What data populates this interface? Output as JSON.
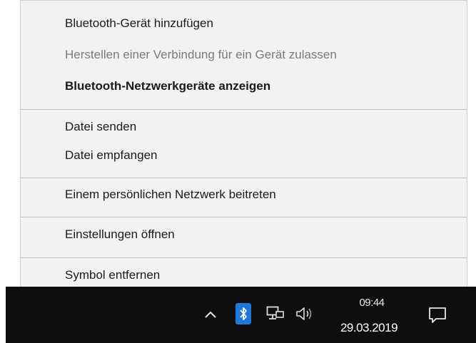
{
  "menu": {
    "items": [
      {
        "label": "Bluetooth-Gerät hinzufügen",
        "state": "normal"
      },
      {
        "label": "Herstellen einer Verbindung für ein Gerät zulassen",
        "state": "disabled"
      },
      {
        "label": "Bluetooth-Netzwerkgeräte anzeigen",
        "state": "bold"
      },
      {
        "label": "Datei senden",
        "state": "normal"
      },
      {
        "label": "Datei empfangen",
        "state": "normal"
      },
      {
        "label": "Einem persönlichen Netzwerk beitreten",
        "state": "normal"
      },
      {
        "label": "Einstellungen öffnen",
        "state": "normal"
      },
      {
        "label": "Symbol entfernen",
        "state": "normal"
      }
    ]
  },
  "taskbar": {
    "tray_icons": [
      "chevron-up-icon",
      "bluetooth-icon",
      "network-icon",
      "speaker-icon",
      "action-center-icon"
    ],
    "clock": {
      "time": "09:44",
      "date": "29.03.2019"
    },
    "accent_color": "#1e78d7"
  }
}
